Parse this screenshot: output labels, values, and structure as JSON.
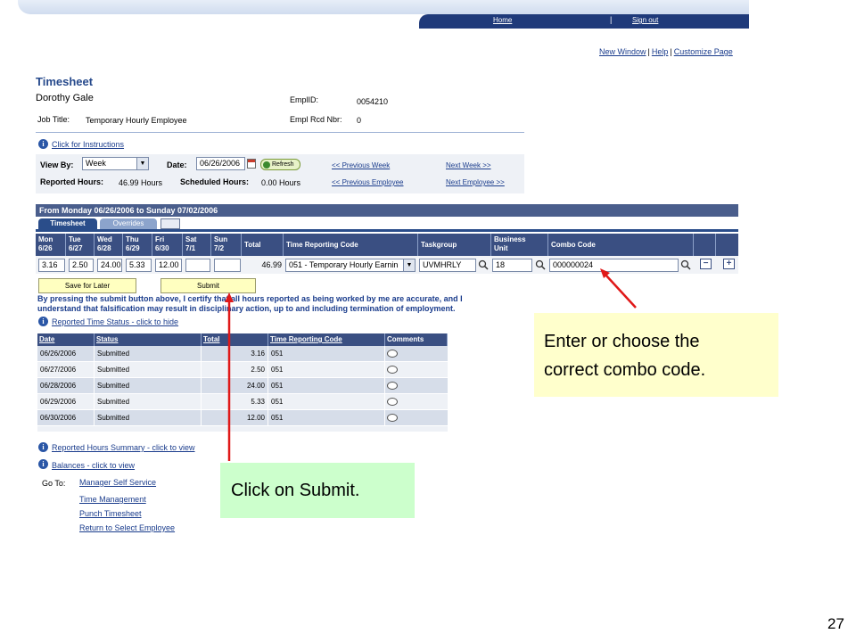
{
  "header": {
    "home_label": "Home",
    "separator": "|",
    "signout_label": "Sign out",
    "new_window_label": "New Window",
    "help_label": "Help",
    "customize_label": "Customize Page"
  },
  "page": {
    "title": "Timesheet",
    "employee_name": "Dorothy Gale",
    "emplid_label": "EmplID:",
    "emplid_value": "0054210",
    "job_title_label": "Job Title:",
    "job_title_value": "Temporary Hourly Employee",
    "empl_rcd_label": "Empl Rcd Nbr:",
    "empl_rcd_value": "0",
    "instructions_link": "Click for Instructions"
  },
  "filters": {
    "view_by_label": "View By:",
    "view_by_value": "Week",
    "date_label": "Date:",
    "date_value": "06/26/2006",
    "refresh_label": "Refresh",
    "prev_week": "<< Previous Week",
    "next_week": "Next Week >>",
    "reported_hours_label": "Reported Hours:",
    "reported_hours_value": "46.99 Hours",
    "scheduled_hours_label": "Scheduled Hours:",
    "scheduled_hours_value": "0.00 Hours",
    "prev_employee": "<< Previous Employee",
    "next_employee": "Next Employee >>"
  },
  "grid": {
    "period_title": "From Monday 06/26/2006 to Sunday 07/02/2006",
    "tabs": [
      "Timesheet",
      "Overrides"
    ],
    "columns": [
      {
        "line1": "Mon",
        "line2": "6/26"
      },
      {
        "line1": "Tue",
        "line2": "6/27"
      },
      {
        "line1": "Wed",
        "line2": "6/28"
      },
      {
        "line1": "Thu",
        "line2": "6/29"
      },
      {
        "line1": "Fri",
        "line2": "6/30"
      },
      {
        "line1": "Sat",
        "line2": "7/1"
      },
      {
        "line1": "Sun",
        "line2": "7/2"
      },
      {
        "line1": "Total",
        "line2": ""
      },
      {
        "line1": "Time Reporting Code",
        "line2": ""
      },
      {
        "line1": "Taskgroup",
        "line2": ""
      },
      {
        "line1": "Business",
        "line2": "Unit"
      },
      {
        "line1": "Combo Code",
        "line2": ""
      }
    ],
    "row": {
      "mon": "3.16",
      "tue": "2.50",
      "wed": "24.00",
      "thu": "5.33",
      "fri": "12.00",
      "sat": "",
      "sun": "",
      "total": "46.99",
      "trc": "051 - Temporary Hourly Earnin",
      "taskgroup": "UVMHRLY",
      "business_unit": "18",
      "combo_code": "000000024"
    },
    "save_later_label": "Save for Later",
    "submit_label": "Submit",
    "certify_text": "By pressing the submit button above, I certify that all hours reported as being worked by me are accurate, and I understand that falsification may result in disciplinary action, up to and including termination of employment."
  },
  "status": {
    "toggle_link": "Reported Time Status - click to hide",
    "headers": [
      "Date",
      "Status",
      "Total",
      "Time Reporting Code",
      "Comments"
    ],
    "rows": [
      {
        "date": "06/26/2006",
        "status": "Submitted",
        "total": "3.16",
        "trc": "051"
      },
      {
        "date": "06/27/2006",
        "status": "Submitted",
        "total": "2.50",
        "trc": "051"
      },
      {
        "date": "06/28/2006",
        "status": "Submitted",
        "total": "24.00",
        "trc": "051"
      },
      {
        "date": "06/29/2006",
        "status": "Submitted",
        "total": "5.33",
        "trc": "051"
      },
      {
        "date": "06/30/2006",
        "status": "Submitted",
        "total": "12.00",
        "trc": "051"
      }
    ]
  },
  "footer": {
    "summary_link": "Reported Hours Summary - click to view",
    "balances_link": "Balances - click to view",
    "goto_label": "Go To:",
    "goto_links": [
      "Manager Self Service",
      "Time Management",
      "Punch Timesheet",
      "Return to Select Employee"
    ]
  },
  "callouts": {
    "combo_line1": "Enter or choose the",
    "combo_line2": "correct combo code.",
    "submit": "Click on Submit."
  },
  "slide_number": "27",
  "colors": {
    "header_blue": "#3a4f82",
    "link_blue": "#1a3c8c",
    "callout_yellow": "#ffffcc",
    "callout_green": "#ccffcc",
    "arrow_red": "#e01818"
  }
}
